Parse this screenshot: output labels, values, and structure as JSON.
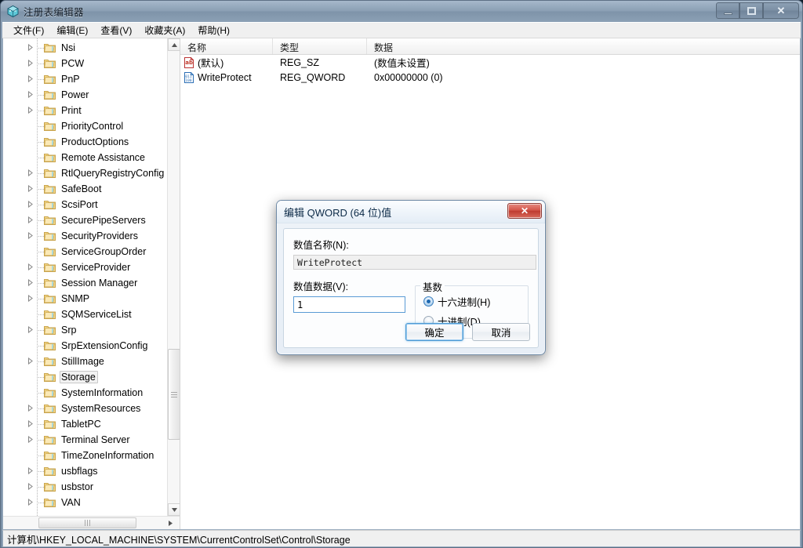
{
  "window": {
    "title": "注册表编辑器",
    "icon": "registry-editor-icon",
    "buttons": {
      "minimize": "minimize-icon",
      "maximize": "maximize-icon",
      "close": "✕"
    }
  },
  "menubar": {
    "items": [
      {
        "label": "文件(F)",
        "name": "menu-file"
      },
      {
        "label": "编辑(E)",
        "name": "menu-edit"
      },
      {
        "label": "查看(V)",
        "name": "menu-view"
      },
      {
        "label": "收藏夹(A)",
        "name": "menu-favorites"
      },
      {
        "label": "帮助(H)",
        "name": "menu-help"
      }
    ]
  },
  "tree": {
    "items": [
      {
        "label": "Nsi",
        "expandable": true,
        "selected": false
      },
      {
        "label": "PCW",
        "expandable": true,
        "selected": false
      },
      {
        "label": "PnP",
        "expandable": true,
        "selected": false
      },
      {
        "label": "Power",
        "expandable": true,
        "selected": false
      },
      {
        "label": "Print",
        "expandable": true,
        "selected": false
      },
      {
        "label": "PriorityControl",
        "expandable": false,
        "selected": false
      },
      {
        "label": "ProductOptions",
        "expandable": false,
        "selected": false
      },
      {
        "label": "Remote Assistance",
        "expandable": false,
        "selected": false
      },
      {
        "label": "RtlQueryRegistryConfig",
        "expandable": true,
        "selected": false
      },
      {
        "label": "SafeBoot",
        "expandable": true,
        "selected": false
      },
      {
        "label": "ScsiPort",
        "expandable": true,
        "selected": false
      },
      {
        "label": "SecurePipeServers",
        "expandable": true,
        "selected": false
      },
      {
        "label": "SecurityProviders",
        "expandable": true,
        "selected": false
      },
      {
        "label": "ServiceGroupOrder",
        "expandable": false,
        "selected": false
      },
      {
        "label": "ServiceProvider",
        "expandable": true,
        "selected": false
      },
      {
        "label": "Session Manager",
        "expandable": true,
        "selected": false
      },
      {
        "label": "SNMP",
        "expandable": true,
        "selected": false
      },
      {
        "label": "SQMServiceList",
        "expandable": false,
        "selected": false
      },
      {
        "label": "Srp",
        "expandable": true,
        "selected": false
      },
      {
        "label": "SrpExtensionConfig",
        "expandable": false,
        "selected": false
      },
      {
        "label": "StillImage",
        "expandable": true,
        "selected": false
      },
      {
        "label": "Storage",
        "expandable": false,
        "selected": true
      },
      {
        "label": "SystemInformation",
        "expandable": false,
        "selected": false
      },
      {
        "label": "SystemResources",
        "expandable": true,
        "selected": false
      },
      {
        "label": "TabletPC",
        "expandable": true,
        "selected": false
      },
      {
        "label": "Terminal Server",
        "expandable": true,
        "selected": false
      },
      {
        "label": "TimeZoneInformation",
        "expandable": false,
        "selected": false
      },
      {
        "label": "usbflags",
        "expandable": true,
        "selected": false
      },
      {
        "label": "usbstor",
        "expandable": true,
        "selected": false
      },
      {
        "label": "VAN",
        "expandable": true,
        "selected": false
      }
    ]
  },
  "list": {
    "columns": [
      "名称",
      "类型",
      "数据"
    ],
    "rows": [
      {
        "icon": "string-value-icon",
        "name": "(默认)",
        "type": "REG_SZ",
        "data": "(数值未设置)"
      },
      {
        "icon": "binary-value-icon",
        "name": "WriteProtect",
        "type": "REG_QWORD",
        "data": "0x00000000 (0)"
      }
    ]
  },
  "statusbar": {
    "path": "计算机\\HKEY_LOCAL_MACHINE\\SYSTEM\\CurrentControlSet\\Control\\Storage"
  },
  "dialog": {
    "title": "编辑 QWORD (64 位)值",
    "close_label": "✕",
    "value_name_label": "数值名称(N):",
    "value_name": "WriteProtect",
    "value_data_label": "数值数据(V):",
    "value_data": "1",
    "base_legend": "基数",
    "radios": [
      {
        "label": "十六进制(H)",
        "checked": true,
        "name": "radio-hexadecimal"
      },
      {
        "label": "十进制(D)",
        "checked": false,
        "name": "radio-decimal"
      }
    ],
    "ok_label": "确定",
    "cancel_label": "取消"
  },
  "colors": {
    "accent": "#1d68b0",
    "title_bar": "#8b9fb4",
    "close_button": "#bf3c30"
  }
}
